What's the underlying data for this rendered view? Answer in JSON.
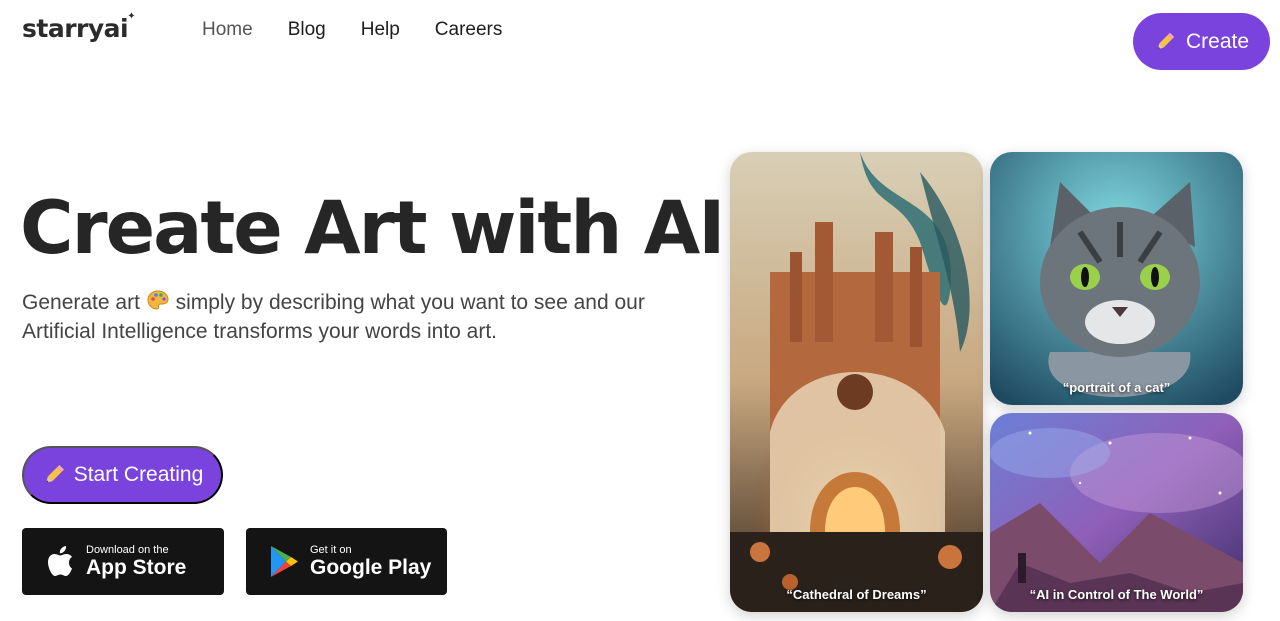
{
  "header": {
    "logo": "starryai",
    "nav": [
      "Home",
      "Blog",
      "Help",
      "Careers"
    ],
    "create_label": "Create"
  },
  "hero": {
    "title": "Create Art with AI",
    "subtitle_part1": "Generate art",
    "subtitle_part2": "simply by describing what you want to see and our Artificial Intelligence transforms your words into art.",
    "start_label": "Start Creating"
  },
  "stores": {
    "apple_small": "Download on the",
    "apple_big": "App Store",
    "google_small": "Get it on",
    "google_big": "Google Play"
  },
  "gallery": [
    {
      "caption": "“Cathedral of Dreams”"
    },
    {
      "caption": "“portrait of a cat”"
    },
    {
      "caption": "“AI in Control of The World”"
    }
  ],
  "colors": {
    "accent": "#7a43de",
    "store_bg": "#141414"
  },
  "icons": [
    "pencil-icon",
    "palette-emoji",
    "apple-icon",
    "google-play-icon"
  ]
}
